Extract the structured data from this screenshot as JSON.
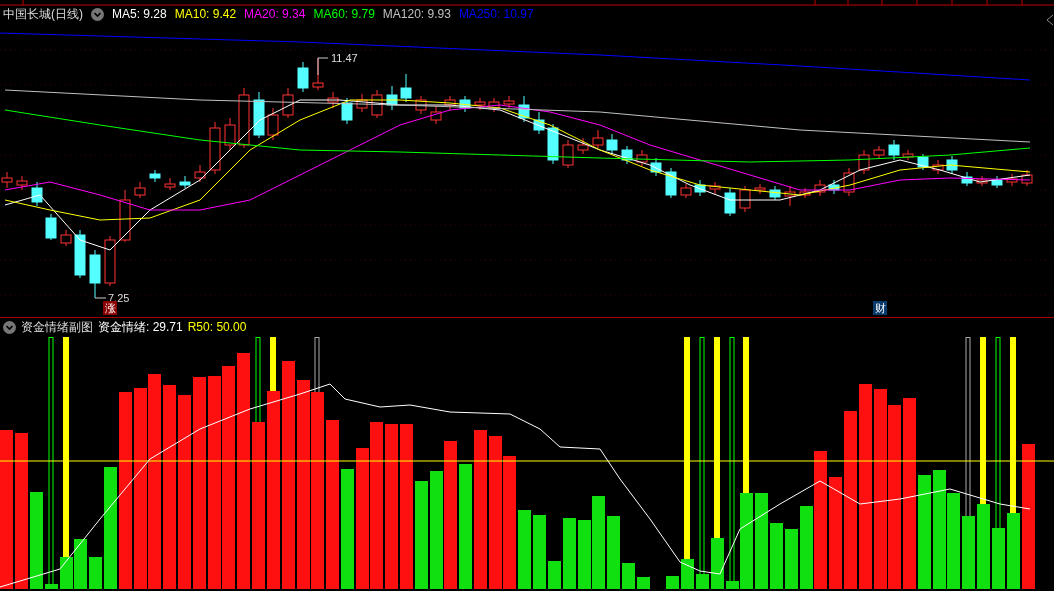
{
  "main_chart": {
    "title": "中国长城(日线)",
    "indicators": [
      {
        "label": "MA5: 9.28",
        "color": "#ffffff"
      },
      {
        "label": "MA10: 9.42",
        "color": "#ffff00"
      },
      {
        "label": "MA20: 9.34",
        "color": "#ff00ff"
      },
      {
        "label": "MA60: 9.79",
        "color": "#00ff00"
      },
      {
        "label": "MA120: 9.93",
        "color": "#c0c0c0"
      },
      {
        "label": "MA250: 10.97",
        "color": "#0000ff"
      }
    ],
    "high_label": "11.47",
    "low_label": "7.25",
    "markers": [
      {
        "text": "涨",
        "color": "#8b0000"
      },
      {
        "text": "财",
        "color": "#0a3a6a"
      }
    ]
  },
  "sub_chart": {
    "title": "资金情绪副图",
    "indicators": [
      {
        "label": "资金情绪: 29.71",
        "color": "#ffffff"
      },
      {
        "label": "R50: 50.00",
        "color": "#ffff00"
      }
    ]
  }
}
